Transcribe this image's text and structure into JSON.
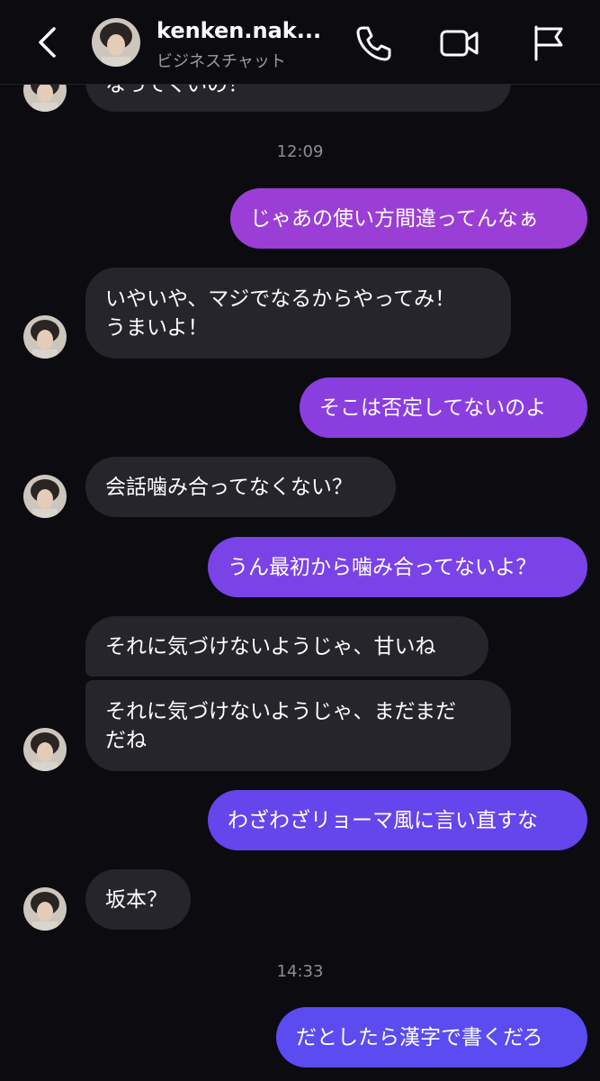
{
  "header": {
    "title": "kenken.nak...",
    "subtitle": "ビジネスチャット"
  },
  "messages": {
    "cut_off_text": "なってくいの！",
    "time1": "12:09",
    "m1": "じゃあの使い方間違ってんなぁ",
    "m2_line1": "いやいや、マジでなるからやってみ！",
    "m2_line2": "うまいよ！",
    "m3": "そこは否定してないのよ",
    "m4": "会話噛み合ってなくない？",
    "m5": "うん最初から噛み合ってないよ？",
    "m6": "それに気づけないようじゃ、甘いね",
    "m7_line1": "それに気づけないようじゃ、まだまだ",
    "m7_line2": "だね",
    "m8": "わざわざリョーマ風に言い直すな",
    "m9": "坂本？",
    "time2": "14:33",
    "m10": "だとしたら漢字で書くだろ"
  },
  "colors": {
    "accent_top": "#9a3fd6",
    "accent_bottom": "#5a4df0",
    "incoming_bubble": "#25252b"
  }
}
